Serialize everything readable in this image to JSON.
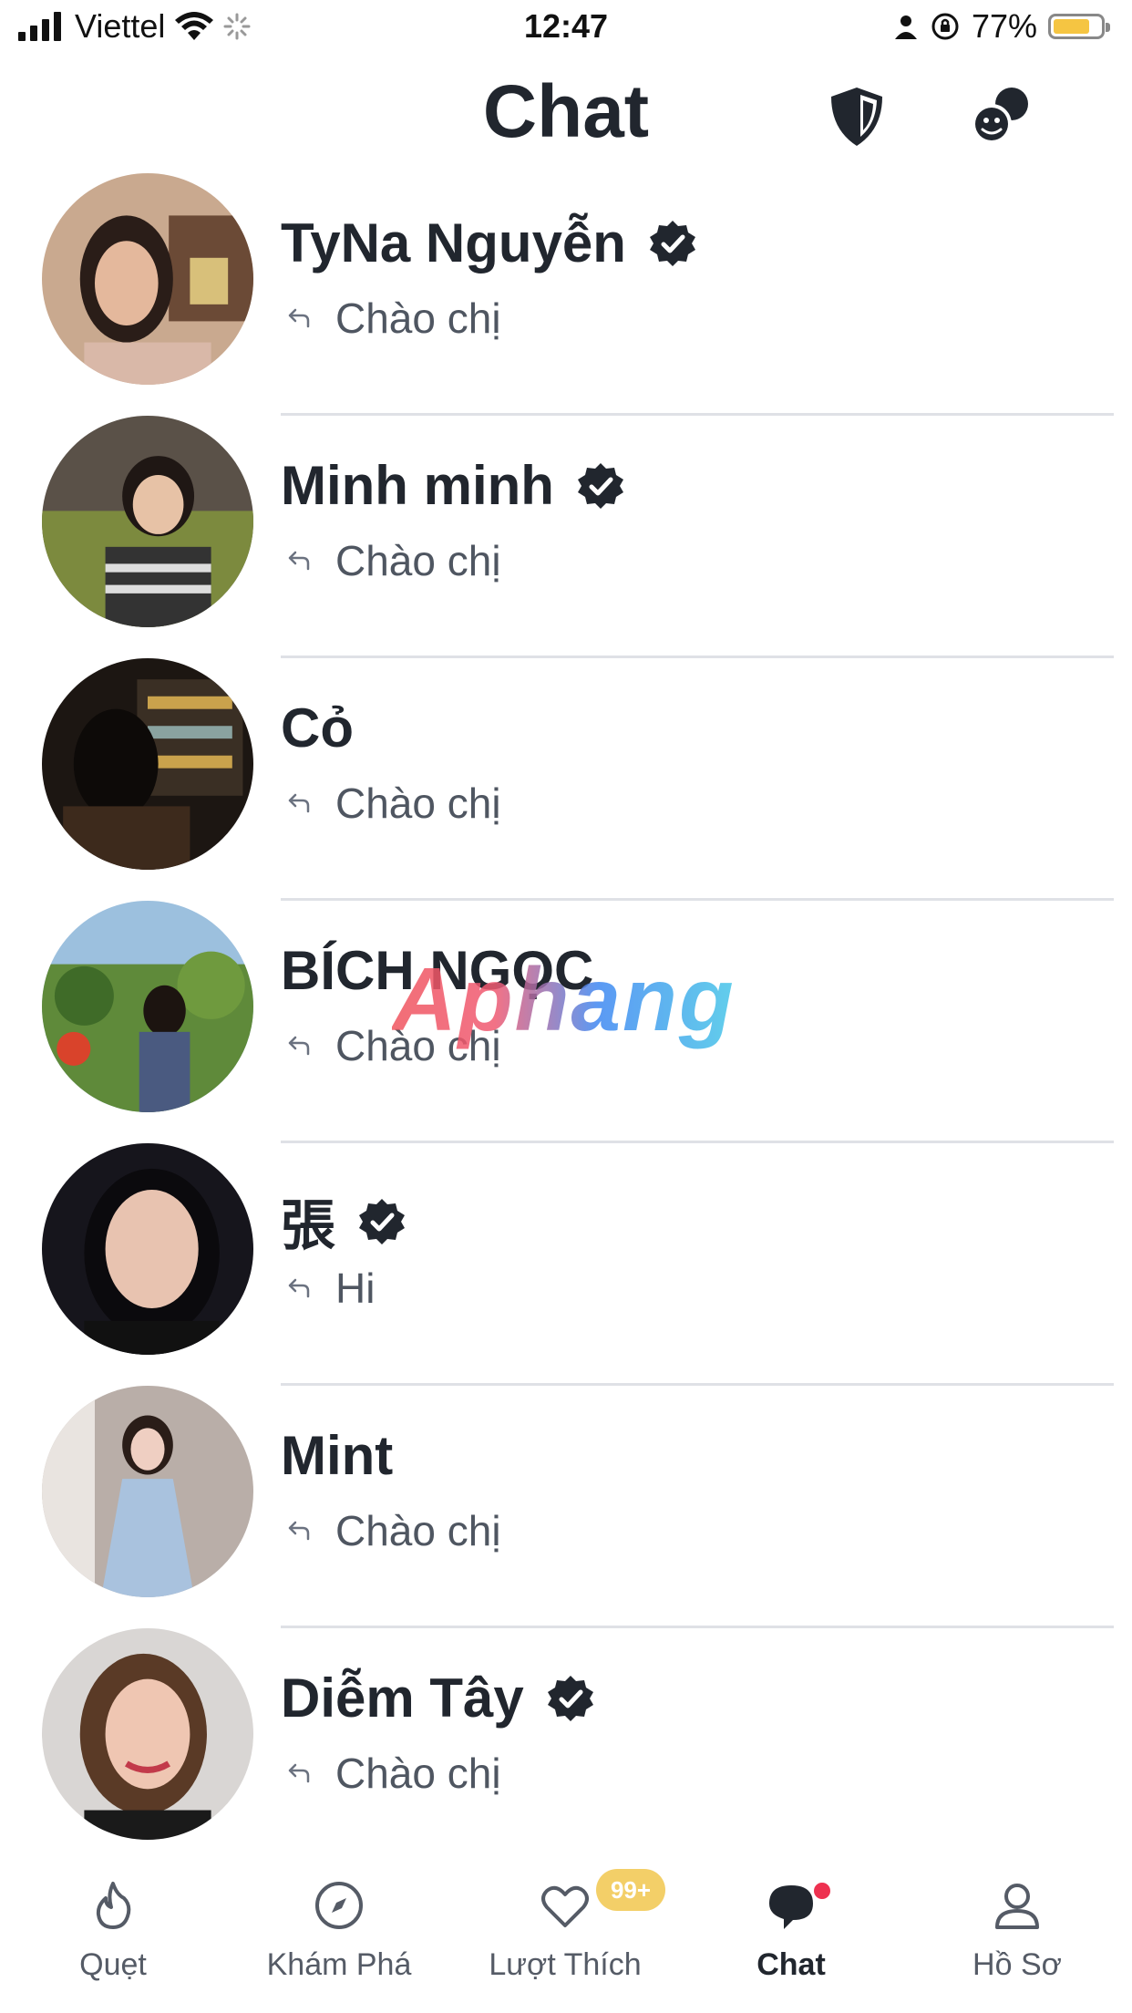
{
  "status_bar": {
    "carrier": "Viettel",
    "time": "12:47",
    "battery": "77%",
    "battery_level": 0.77
  },
  "header": {
    "title": "Chat"
  },
  "conversations": [
    {
      "name": "TyNa Nguyễn",
      "verified": true,
      "last_message": "Chào chị"
    },
    {
      "name": "Minh minh",
      "verified": true,
      "last_message": "Chào chị"
    },
    {
      "name": "Cỏ",
      "verified": false,
      "last_message": "Chào chị"
    },
    {
      "name": "BÍCH NGỌC",
      "verified": false,
      "last_message": "Chào chị"
    },
    {
      "name": "張",
      "verified": true,
      "last_message": "Hi"
    },
    {
      "name": "Mint",
      "verified": false,
      "last_message": "Chào chị"
    },
    {
      "name": "Diễm Tây",
      "verified": true,
      "last_message": "Chào chị"
    }
  ],
  "watermark": "Aphang",
  "tabs": [
    {
      "label": "Quẹt",
      "icon": "flame-icon"
    },
    {
      "label": "Khám Phá",
      "icon": "compass-icon"
    },
    {
      "label": "Lượt Thích",
      "icon": "heart-icon",
      "badge": "99+"
    },
    {
      "label": "Chat",
      "icon": "chat-bubble-icon",
      "active": true
    },
    {
      "label": "Hồ Sơ",
      "icon": "profile-icon"
    }
  ],
  "colors": {
    "text": "#21262e",
    "secondary_text": "#4f5661",
    "divider": "#dfe1e6",
    "likes_badge": "#f3cf68",
    "notification_dot": "#ee3150",
    "battery": "#f5c542"
  }
}
